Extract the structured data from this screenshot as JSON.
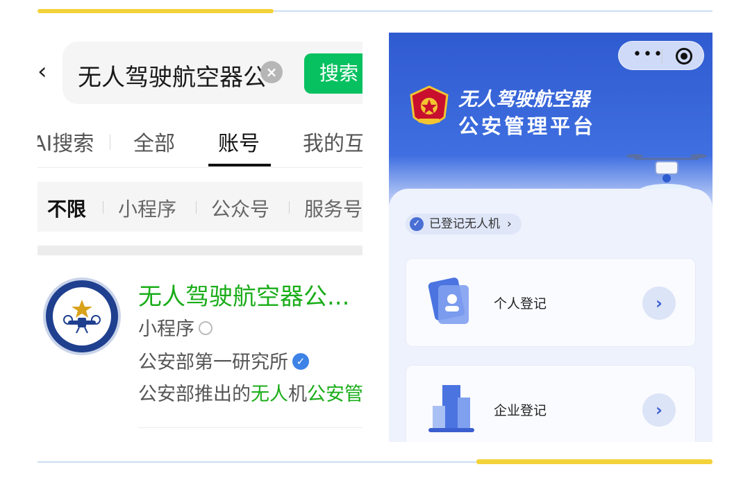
{
  "search": {
    "query": "无人驾驶航空器公",
    "button_label": "搜索"
  },
  "tabs": [
    "AI搜索",
    "全部",
    "账号",
    "我的互"
  ],
  "filters": [
    "不限",
    "小程序",
    "公众号",
    "服务号"
  ],
  "result": {
    "title": "无人驾驶航空器公...",
    "type": "小程序",
    "org": "公安部第一研究所",
    "desc_prefix": "公安部推出的",
    "desc_hl1": "无人",
    "desc_mid": "机",
    "desc_hl2": "公安管"
  },
  "app": {
    "title_line1": "无人驾驶航空器",
    "title_line2": "公安管理平台",
    "registered_label": "已登记无人机",
    "cards": [
      "个人登记",
      "企业登记"
    ]
  },
  "colors": {
    "wechat_green": "#07c160",
    "highlight_green": "#1aad19",
    "app_blue": "#2f5bd0",
    "accent_yellow": "#f3d23a"
  }
}
